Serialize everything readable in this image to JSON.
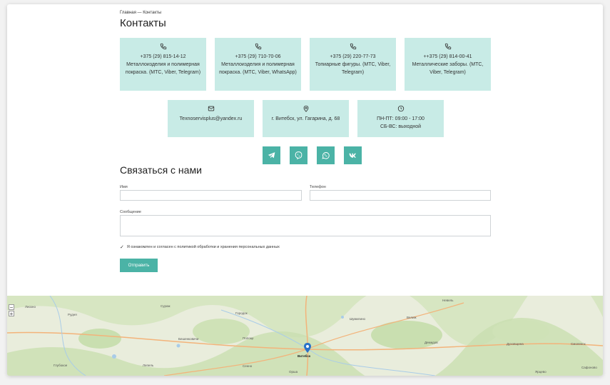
{
  "breadcrumb": {
    "home": "Главная",
    "separator": "—",
    "current": "Контакты"
  },
  "page_title": "Контакты",
  "phone_cards": [
    {
      "icon": "phone-icon",
      "line1": "+375 (29) 815-14-12",
      "line2": "Металлоизделия и полимерная покраска. (МТС, Viber, Telegram)"
    },
    {
      "icon": "phone-icon",
      "line1": "+375 (29) 710-70-06",
      "line2": "Металлоизделия и полимерная покраска. (МТС, Viber, WhatsApp)"
    },
    {
      "icon": "phone-icon",
      "line1": "+375 (29) 220-77-73",
      "line2": "Топиарные фигуры. (МТС, Viber, Telegram)"
    },
    {
      "icon": "phone-icon",
      "line1": "++375 (29) 814-00-41",
      "line2": "Металлические заборы. (МТС, Viber, Telegram)"
    }
  ],
  "info_cards": [
    {
      "icon": "mail-icon",
      "line1": "Texnoservisplus@yandex.ru",
      "line2": ""
    },
    {
      "icon": "location-pin-icon",
      "line1": "г. Витебск, ул. Гагарина, д. 68",
      "line2": ""
    },
    {
      "icon": "clock-icon",
      "line1": "ПН-ПТ: 09:00 - 17:00",
      "line2": "СБ-ВС: выходной"
    }
  ],
  "socials": [
    "telegram-icon",
    "viber-icon",
    "whatsapp-icon",
    "vk-icon"
  ],
  "form": {
    "title": "Связаться с нами",
    "name_label": "Имя",
    "name_value": "",
    "phone_label": "Телефон",
    "phone_value": "",
    "message_label": "Сообщение",
    "message_value": "",
    "consent_text": "Я ознакомлен и согласен с политикой обработки и хранения персональных данных",
    "consent_checked": true,
    "submit_label": "Отправить"
  },
  "map": {
    "marker_city": "Витебск",
    "places": [
      "Лиозно",
      "Рудня",
      "Сураж",
      "Городок",
      "Шумилино",
      "Бешенковичи",
      "Полоцк",
      "Глубокое",
      "Лепель",
      "Сенно",
      "Орша",
      "Невель",
      "Велиж",
      "Демидов",
      "Духовщина",
      "Ярцево",
      "Сафоново",
      "Смоленск"
    ],
    "zoom_in": "+",
    "zoom_out": "−",
    "colors": {
      "land": "#e9eddc",
      "forest": "#c9dfb0",
      "water": "#a9cce8",
      "road": "#f3b37a"
    }
  },
  "accent_color": "#4bb3a6",
  "card_color": "#c8ebe6"
}
